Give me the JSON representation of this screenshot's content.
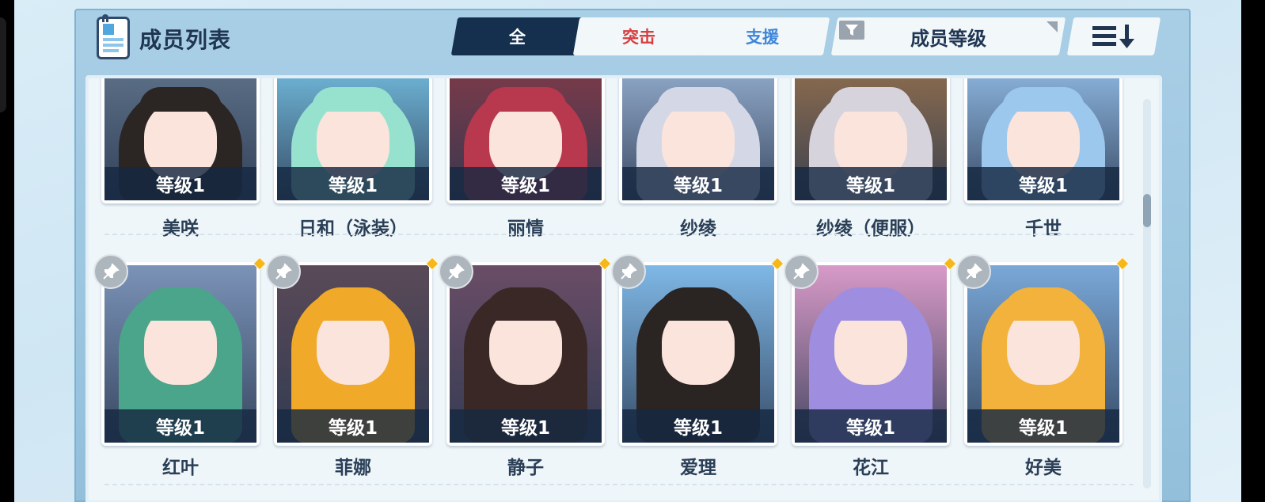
{
  "header": {
    "title": "成员列表",
    "tabs": [
      {
        "label": "全",
        "active": true,
        "color": "#ffffff"
      },
      {
        "label": "突击",
        "active": false,
        "color": "#d63f3f"
      },
      {
        "label": "支援",
        "active": false,
        "color": "#3e86d8"
      }
    ],
    "sort_label": "成员等级"
  },
  "members": [
    {
      "level": "等级1",
      "name": "美咲",
      "pinned": false,
      "new": false,
      "bg": "#5b6f86",
      "hair": "#2b2624"
    },
    {
      "level": "等级1",
      "name": "日和（泳装）",
      "pinned": false,
      "new": false,
      "bg": "#6fb4d6",
      "hair": "#96e2cf"
    },
    {
      "level": "等级1",
      "name": "丽情",
      "pinned": false,
      "new": false,
      "bg": "#7a3a4a",
      "hair": "#b8384e"
    },
    {
      "level": "等级1",
      "name": "纱绫",
      "pinned": false,
      "new": false,
      "bg": "#8fa8c8",
      "hair": "#d4d8e6"
    },
    {
      "level": "等级1",
      "name": "纱绫（便服）",
      "pinned": false,
      "new": false,
      "bg": "#8a6b4e",
      "hair": "#d6d3dc"
    },
    {
      "level": "等级1",
      "name": "千世",
      "pinned": false,
      "new": false,
      "bg": "#8bb3dc",
      "hair": "#9cc8ee"
    },
    {
      "level": "等级1",
      "name": "红叶",
      "pinned": true,
      "new": true,
      "bg": "#7b93b8",
      "hair": "#4aa58a"
    },
    {
      "level": "等级1",
      "name": "菲娜",
      "pinned": true,
      "new": true,
      "bg": "#5a4a58",
      "hair": "#f0a928"
    },
    {
      "level": "等级1",
      "name": "静子",
      "pinned": true,
      "new": true,
      "bg": "#6a4d66",
      "hair": "#3a2826"
    },
    {
      "level": "等级1",
      "name": "爱理",
      "pinned": true,
      "new": true,
      "bg": "#7fb8e6",
      "hair": "#2a2422"
    },
    {
      "level": "等级1",
      "name": "花江",
      "pinned": true,
      "new": true,
      "bg": "#d89ac8",
      "hair": "#9f8ee0"
    },
    {
      "level": "等级1",
      "name": "好美",
      "pinned": true,
      "new": true,
      "bg": "#7aa8d8",
      "hair": "#f2b23c"
    }
  ],
  "colors": {
    "accent": "#152f4f",
    "new_marker": "#f6b818"
  },
  "icons": [
    "member-list-icon",
    "filter-icon",
    "sort-order-icon",
    "pin-icon"
  ]
}
